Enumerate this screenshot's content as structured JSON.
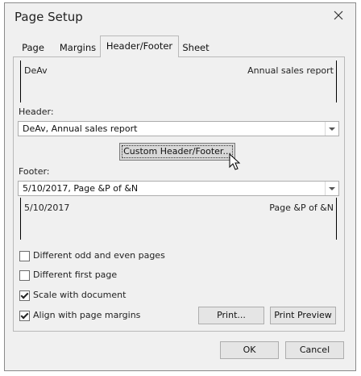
{
  "window": {
    "title": "Page Setup"
  },
  "tabs": [
    {
      "label": "Page"
    },
    {
      "label": "Margins"
    },
    {
      "label": "Header/Footer"
    },
    {
      "label": "Sheet"
    }
  ],
  "header_preview": {
    "left": "DeAv",
    "right": "Annual sales report"
  },
  "header": {
    "label": "Header:",
    "value": "DeAv, Annual sales report"
  },
  "custom_button": {
    "label": "Custom Header/Footer..."
  },
  "footer": {
    "label": "Footer:",
    "value": "5/10/2017, Page &P of &N"
  },
  "footer_preview": {
    "left": "5/10/2017",
    "right": "Page &P of &N"
  },
  "options": [
    {
      "label": "Different odd and even pages",
      "checked": false
    },
    {
      "label": "Different first page",
      "checked": false
    },
    {
      "label": "Scale with document",
      "checked": true
    },
    {
      "label": "Align with page margins",
      "checked": true
    }
  ],
  "buttons": {
    "print": "Print...",
    "print_preview": "Print Preview",
    "ok": "OK",
    "cancel": "Cancel"
  }
}
